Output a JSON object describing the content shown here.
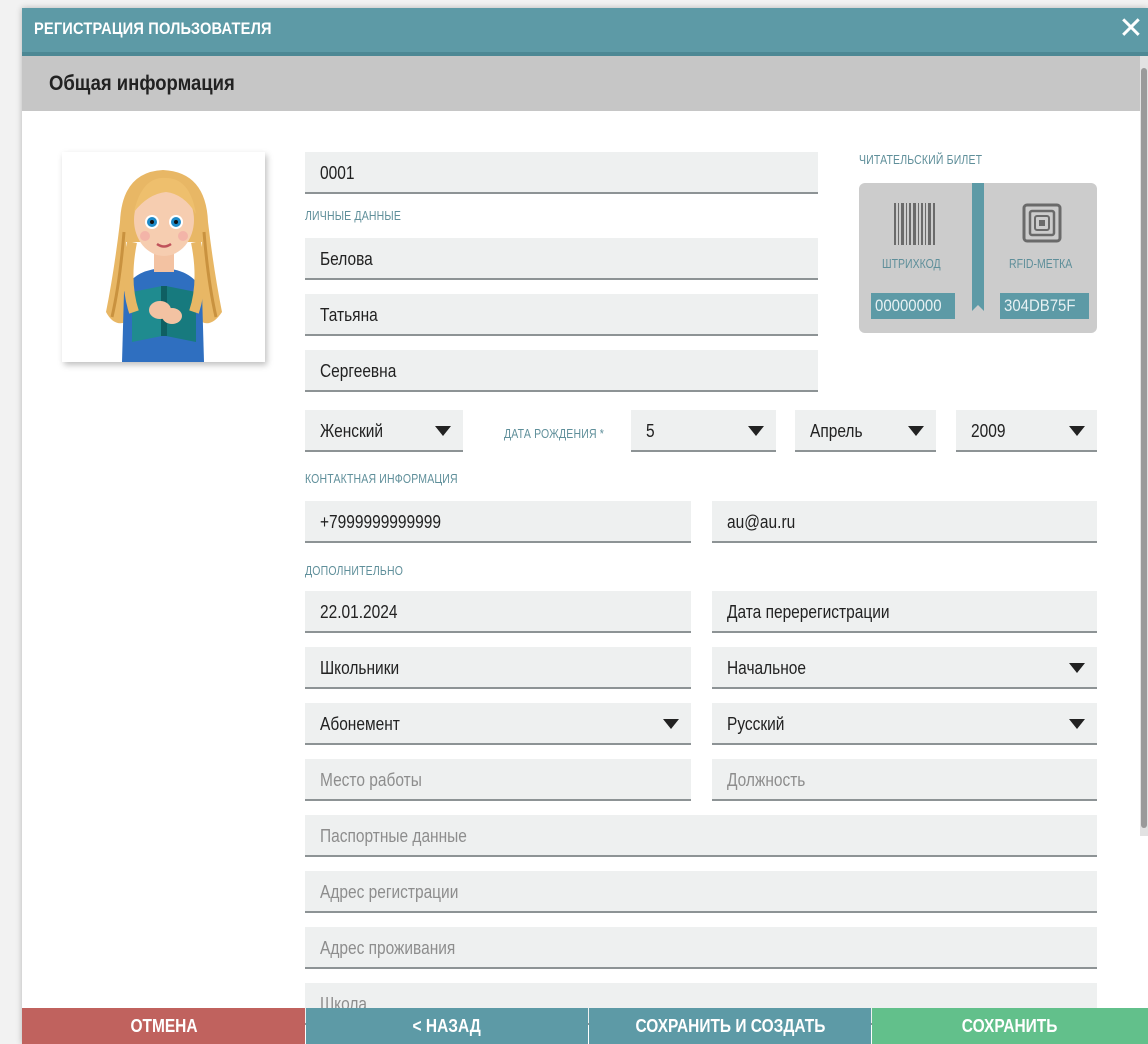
{
  "window": {
    "title": "РЕГИСТРАЦИЯ ПОЛЬЗОВАТЕЛЯ",
    "close_glyph": "✕"
  },
  "section": {
    "title": "Общая информация"
  },
  "form": {
    "card_number": "0001",
    "personal_label": "ЛИЧНЫЕ ДАННЫЕ",
    "last_name": "Белова",
    "first_name": "Татьяна",
    "middle_name": "Сергеевна",
    "gender": "Женский",
    "birth_label": "ДАТА РОЖДЕНИЯ *",
    "birth_day": "5",
    "birth_month": "Апрель",
    "birth_year": "2009",
    "contact_label": "КОНТАКТНАЯ ИНФОРМАЦИЯ",
    "phone": "+7999999999999",
    "email": "au@au.ru",
    "extra_label": "ДОПОЛНИТЕЛЬНО",
    "reg_date": "22.01.2024",
    "rereg_placeholder": "Дата перерегистрации",
    "category": "Школьники",
    "education": "Начальное",
    "service": "Абонемент",
    "language": "Русский",
    "workplace_placeholder": "Место работы",
    "position_placeholder": "Должность",
    "passport_placeholder": "Паспортные данные",
    "reg_address_placeholder": "Адрес регистрации",
    "live_address_placeholder": "Адрес проживания",
    "school_placeholder": "Школа"
  },
  "reader_card": {
    "label": "ЧИТАТЕЛЬСКИЙ БИЛЕТ",
    "barcode_caption": "ШТРИХКОД",
    "barcode_value": "00000000",
    "rfid_caption": "RFID-МЕТКА",
    "rfid_value": "304DB75F",
    "barcode_icon": "barcode-icon",
    "rfid_icon": "rfid-icon"
  },
  "buttons": {
    "cancel": "ОТМЕНА",
    "back": "< НАЗАД",
    "save_create": "СОХРАНИТЬ И СОЗДАТЬ",
    "save": "СОХРАНИТЬ"
  },
  "colors": {
    "header": "#5d9aa6",
    "cancel": "#c0625e",
    "back": "#5d9aa6",
    "save_create": "#5d9aa6",
    "save": "#62c08b"
  }
}
